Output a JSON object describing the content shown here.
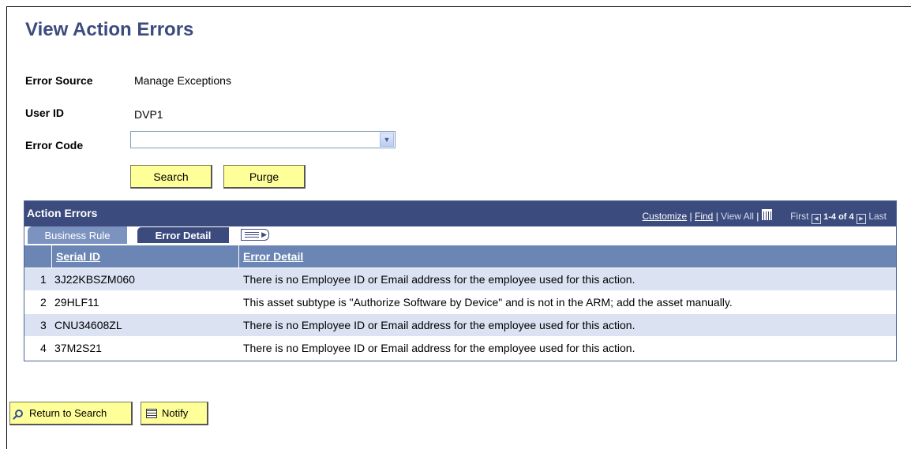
{
  "page": {
    "title": "View Action Errors"
  },
  "fields": {
    "error_source_label": "Error Source",
    "error_source_value": "Manage Exceptions",
    "user_id_label": "User ID",
    "user_id_value": "DVP1",
    "error_code_label": "Error Code",
    "error_code_value": ""
  },
  "buttons": {
    "search": "Search",
    "purge": "Purge"
  },
  "grid": {
    "title": "Action Errors",
    "nav": {
      "customize": "Customize",
      "find": "Find",
      "view_all": "View All",
      "first": "First",
      "range": "1-4 of 4",
      "last": "Last"
    },
    "tabs": [
      {
        "label": "Business Rule",
        "active": false
      },
      {
        "label": "Error Detail",
        "active": true
      }
    ],
    "columns": [
      "Serial ID",
      "Error Detail"
    ],
    "rows": [
      {
        "num": "1",
        "serial": "3J22KBSZM060",
        "detail": "There is no Employee ID or Email address for the employee used for this action."
      },
      {
        "num": "2",
        "serial": "29HLF11",
        "detail": "This asset subtype is \"Authorize Software by Device\" and is not  in the ARM; add the asset manually."
      },
      {
        "num": "3",
        "serial": "CNU34608ZL",
        "detail": "There is no Employee ID or Email address for the employee used for this action."
      },
      {
        "num": "4",
        "serial": "37M2S21",
        "detail": "There is no Employee ID or Email address for the employee used for this action."
      }
    ]
  },
  "footer": {
    "return_to_search": "Return to Search",
    "notify": "Notify"
  }
}
